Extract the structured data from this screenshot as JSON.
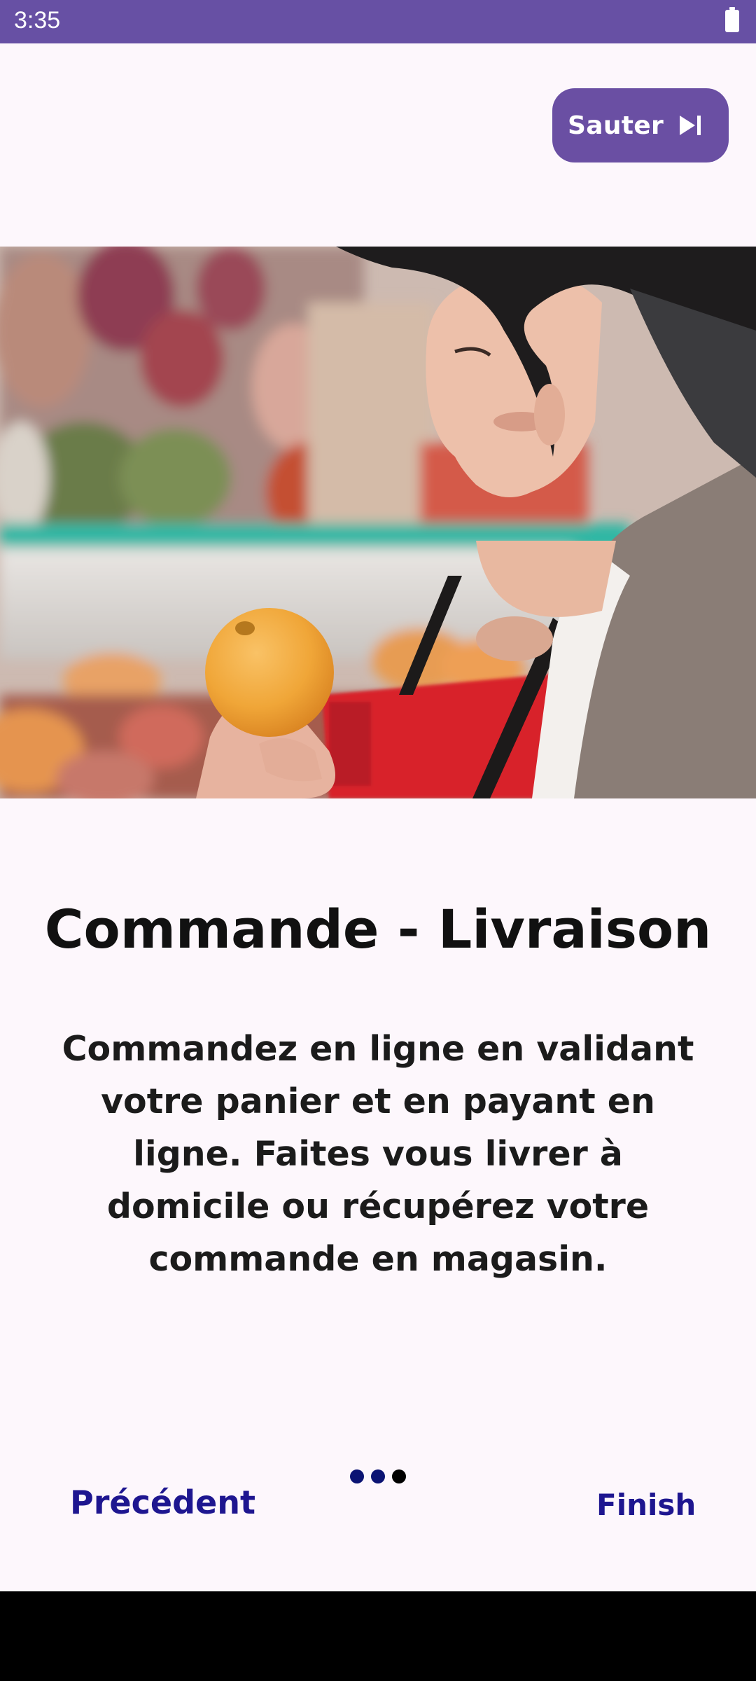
{
  "status_bar": {
    "time": "3:35",
    "battery_icon": "battery-icon"
  },
  "skip": {
    "label": "Sauter",
    "icon": "skip-next-icon"
  },
  "hero": {
    "image": "woman-holding-orange-photo"
  },
  "content": {
    "title": "Commande - Livraison",
    "description": "Commandez en ligne en validant votre panier et en payant en ligne. Faites vous livrer à domicile ou récupérez votre commande en magasin."
  },
  "footer": {
    "previous_label": "Précédent",
    "finish_label": "Finish",
    "page_count": 3,
    "current_page": 3
  },
  "colors": {
    "accent": "#6750A4",
    "button": "#6A4FA3",
    "nav_text": "#1E1690",
    "background": "#FDF7FC"
  }
}
